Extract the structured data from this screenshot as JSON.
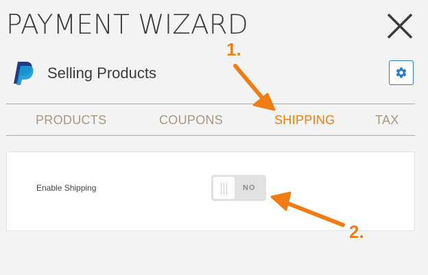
{
  "header": {
    "title": "PAYMENT WIZARD",
    "close_icon": "close-icon"
  },
  "integration": {
    "logo_icon": "paypal-icon",
    "name": "Selling Products",
    "settings_icon": "gear-icon"
  },
  "tabs": [
    {
      "label": "PRODUCTS",
      "active": false
    },
    {
      "label": "COUPONS",
      "active": false
    },
    {
      "label": "SHIPPING",
      "active": true
    },
    {
      "label": "TAX",
      "active": false
    }
  ],
  "shipping": {
    "enable_label": "Enable Shipping",
    "toggle_state": "NO"
  },
  "annotations": {
    "step1": "1.",
    "step2": "2."
  },
  "colors": {
    "accent": "#f07c13",
    "tab_text": "#a8977e",
    "divider": "#b8a68e",
    "button_border": "#2b7fc7"
  }
}
